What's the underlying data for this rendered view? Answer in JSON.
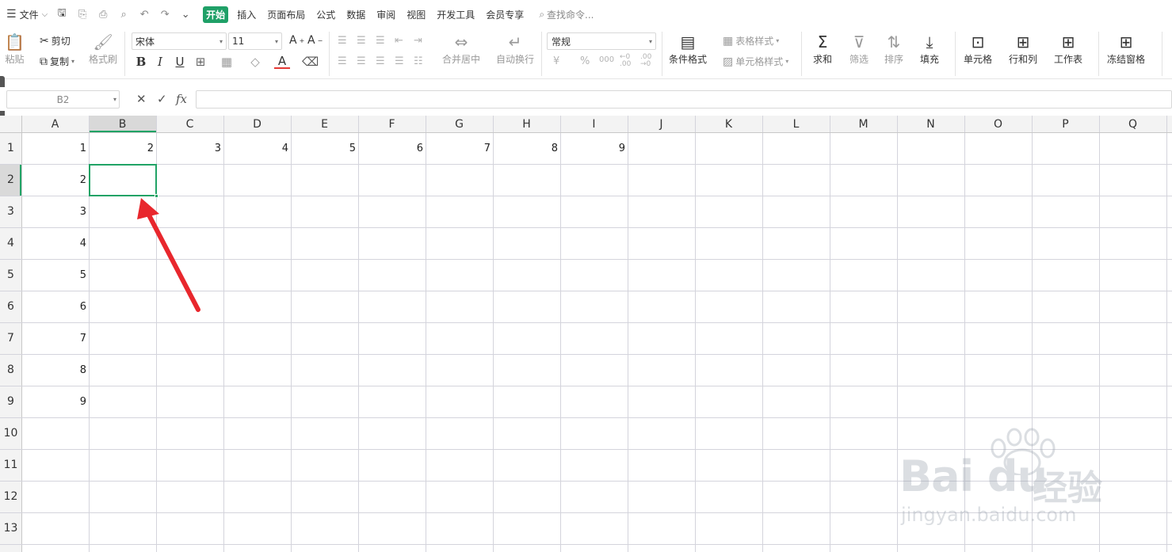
{
  "menubar": {
    "file": "文件",
    "tabs": [
      "开始",
      "插入",
      "页面布局",
      "公式",
      "数据",
      "审阅",
      "视图",
      "开发工具",
      "会员专享"
    ],
    "active_tab": "开始",
    "search_placeholder": "查找命令..."
  },
  "ribbon": {
    "paste": "粘贴",
    "cut": "剪切",
    "copy": "复制",
    "format_painter": "格式刷",
    "font_name": "宋体",
    "font_size": "11",
    "bold": "B",
    "italic": "I",
    "underline": "U",
    "merge_center": "合并居中",
    "wrap_text": "自动换行",
    "number_format": "常规",
    "currency_symbol": "¥",
    "percent_symbol": "%",
    "thousands": "000",
    "conditional_format": "条件格式",
    "table_style": "表格样式",
    "cell_style": "单元格样式",
    "sum": "求和",
    "filter": "筛选",
    "sort": "排序",
    "fill": "填充",
    "cell": "单元格",
    "row_col": "行和列",
    "worksheet": "工作表",
    "freeze": "冻结窗格"
  },
  "formula_bar": {
    "name_box": "B2",
    "cancel": "✕",
    "confirm": "✓",
    "fx": "fx",
    "value": ""
  },
  "sheet": {
    "columns": [
      "A",
      "B",
      "C",
      "D",
      "E",
      "F",
      "G",
      "H",
      "I",
      "J",
      "K",
      "L",
      "M",
      "N",
      "O",
      "P",
      "Q"
    ],
    "rows": [
      "1",
      "2",
      "3",
      "4",
      "5",
      "6",
      "7",
      "8",
      "9",
      "10",
      "11",
      "12",
      "13"
    ],
    "row1": [
      "1",
      "2",
      "3",
      "4",
      "5",
      "6",
      "7",
      "8",
      "9"
    ],
    "colA": [
      "1",
      "2",
      "3",
      "4",
      "5",
      "6",
      "7",
      "8",
      "9"
    ],
    "selected_cell": "B2",
    "selected_col": "B",
    "selected_row": "2",
    "accent": "#21a366",
    "annotation_arrow_color": "#e8272d"
  },
  "watermark": {
    "brand": "Bai du",
    "brand_cn": "经验",
    "url": "jingyan.baidu.com"
  }
}
